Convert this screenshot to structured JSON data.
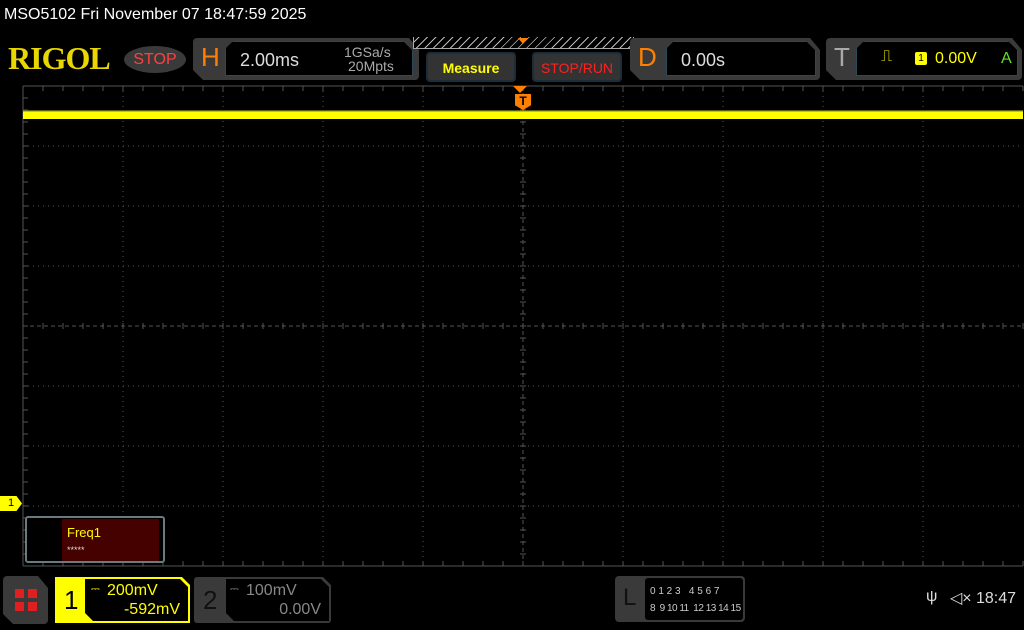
{
  "header": {
    "title": "MSO5102  Fri November 07 18:47:59 2025",
    "logo": "RIGOL",
    "run_state": "STOP"
  },
  "horizontal": {
    "letter": "H",
    "timebase": "2.00ms",
    "sample_rate": "1GSa/s",
    "memory_depth": "20Mpts"
  },
  "buttons": {
    "measure": "Measure",
    "stop_run": "STOP/RUN"
  },
  "delay": {
    "letter": "D",
    "value": "0.00s"
  },
  "trigger": {
    "letter": "T",
    "source": "1",
    "level": "0.00V",
    "mode": "A",
    "slope_icon": "rising-edge-icon",
    "marker": "T"
  },
  "channels": [
    {
      "num": "1",
      "scale": "200mV",
      "offset": "-592mV",
      "color": "#ffff00",
      "active": true
    },
    {
      "num": "2",
      "scale": "100mV",
      "offset": "0.00V",
      "color": "#888888",
      "active": false
    }
  ],
  "ch1_marker": "1",
  "measurement": {
    "label": "Freq1",
    "value": "*****"
  },
  "logic": {
    "letter": "L",
    "row1": "0 1 2 3   4 5 6 7",
    "row2": "8  9 10 11  12 13 14 15"
  },
  "status": {
    "usb_icon": "usb-icon",
    "sound_icon": "speaker-muted-icon",
    "time": "18:47"
  },
  "colors": {
    "trace": "#ffff00",
    "accent": "#ff8000",
    "grid": "#555555"
  }
}
